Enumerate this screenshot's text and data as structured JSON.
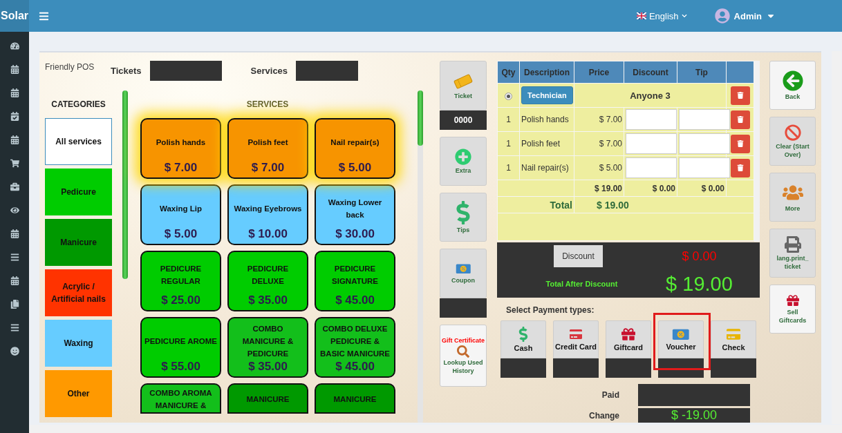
{
  "app": {
    "logo": "Solar"
  },
  "topbar": {
    "language": "English",
    "user": "Admin"
  },
  "header": {
    "brand": "Friendly POS",
    "tickets_label": "Tickets",
    "services_label": "Services"
  },
  "categories": {
    "title": "CATEGORIES",
    "items": [
      {
        "label": "All services",
        "color": "#ffffff",
        "selected": true
      },
      {
        "label": "Pedicure",
        "color": "#00cc00",
        "selected": false
      },
      {
        "label": "Manicure",
        "color": "#009900",
        "selected": false
      },
      {
        "label": "Acrylic / Artificial nails",
        "color": "#ff3300",
        "selected": false
      },
      {
        "label": "Waxing",
        "color": "#66ccff",
        "selected": false
      },
      {
        "label": "Other",
        "color": "#ff9900",
        "selected": false
      }
    ]
  },
  "services": {
    "title": "SERVICES",
    "items": [
      {
        "name": "Polish hands",
        "price": "$ 7.00",
        "color": "#f79400",
        "selected": true
      },
      {
        "name": "Polish feet",
        "price": "$ 7.00",
        "color": "#f79400",
        "selected": true
      },
      {
        "name": "Nail repair(s)",
        "price": "$ 5.00",
        "color": "#f79400",
        "selected": true
      },
      {
        "name": "Waxing Lip",
        "price": "$ 5.00",
        "color": "#66ccff",
        "selected": false
      },
      {
        "name": "Waxing Eyebrows",
        "price": "$ 10.00",
        "color": "#66ccff",
        "selected": false
      },
      {
        "name": "Waxing Lower back",
        "price": "$ 30.00",
        "color": "#66ccff",
        "selected": false
      },
      {
        "name": "PEDICURE REGULAR",
        "price": "$ 25.00",
        "color": "#00cc00",
        "selected": false
      },
      {
        "name": "PEDICURE DELUXE",
        "price": "$ 35.00",
        "color": "#00cc00",
        "selected": false
      },
      {
        "name": "PEDICURE SIGNATURE",
        "price": "$ 45.00",
        "color": "#00cc00",
        "selected": false
      },
      {
        "name": "PEDICURE AROME",
        "price": "$ 55.00",
        "color": "#00cc00",
        "selected": false
      },
      {
        "name": "COMBO MANICURE & PEDICURE",
        "price": "$ 35.00",
        "color": "#13bf1b",
        "selected": false
      },
      {
        "name": "COMBO DELUXE PEDICURE & BASIC MANICURE",
        "price": "$ 45.00",
        "color": "#13bf1b",
        "selected": false
      },
      {
        "name": "COMBO AROMA MANICURE &",
        "color": "#13bf1b",
        "selected": false
      },
      {
        "name": "MANICURE",
        "color": "#009900",
        "selected": false
      },
      {
        "name": "MANICURE",
        "color": "#009900",
        "selected": false
      }
    ]
  },
  "tools": [
    {
      "kind": "ticket",
      "label": "Ticket",
      "value": "0000"
    },
    {
      "kind": "extra",
      "label": "Extra"
    },
    {
      "kind": "tips",
      "label": "Tips"
    },
    {
      "kind": "coupon",
      "label": "Coupon"
    },
    {
      "kind": "gift",
      "title": "Gift Certificate",
      "label": "Lookup Used History"
    }
  ],
  "order": {
    "columns": [
      "Qty",
      "Description",
      "Price",
      "Discount",
      "Tip"
    ],
    "rows": [
      {
        "kind": "technician",
        "checked": true,
        "button": "Technician",
        "name": "Anyone 3"
      },
      {
        "kind": "item",
        "qty": "1",
        "description": "Polish hands",
        "price": "$ 7.00"
      },
      {
        "kind": "item",
        "qty": "1",
        "description": "Polish feet",
        "price": "$ 7.00"
      },
      {
        "kind": "item",
        "qty": "1",
        "description": "Nail repair(s)",
        "price": "$ 5.00"
      }
    ],
    "totals": [
      "$ 19.00",
      "$ 0.00",
      "$ 0.00"
    ],
    "total_label": "Total",
    "total_value": "$ 19.00"
  },
  "summary": {
    "discount_button": "Discount",
    "discount_value": "$ 0.00",
    "after_label": "Total After Discount",
    "after_value": "$ 19.00"
  },
  "payment": {
    "title": "Select Payment types:",
    "types": [
      {
        "kind": "cash",
        "label": "Cash",
        "highlighted": false
      },
      {
        "kind": "card",
        "label": "Credit Card",
        "highlighted": false
      },
      {
        "kind": "giftcard",
        "label": "Giftcard",
        "highlighted": false
      },
      {
        "kind": "voucher",
        "label": "Voucher",
        "highlighted": true
      },
      {
        "kind": "check",
        "label": "Check",
        "highlighted": false
      }
    ],
    "paid_label": "Paid",
    "change_label": "Change",
    "change_value": "$ -19.00"
  },
  "actions": [
    {
      "kind": "back",
      "label": "Back"
    },
    {
      "kind": "clear",
      "label": "Clear (Start Over)"
    },
    {
      "kind": "more",
      "label": "More"
    },
    {
      "kind": "print",
      "label": "lang.print_ticket"
    },
    {
      "kind": "sell",
      "label": "Sell Giftcards"
    }
  ]
}
